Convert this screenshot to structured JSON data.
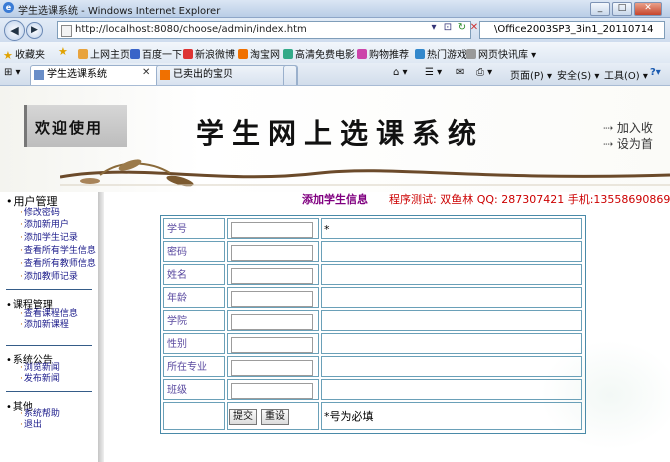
{
  "window": {
    "title": "学生选课系统 - Windows Internet Explorer",
    "btn_min": "_",
    "btn_max": "□",
    "btn_close": "✕"
  },
  "address": {
    "url": "http://localhost:8080/choose/admin/index.htm",
    "search_text": "\\Office2003SP3_3in1_20110714"
  },
  "favorites": {
    "label": "收藏夹",
    "items": [
      "上网主页",
      "百度一下",
      "新浪微博",
      "淘宝网",
      "高清免费电影",
      "购物推荐",
      "热门游戏",
      "网页快讯库"
    ]
  },
  "tabs": {
    "active": "学生选课系统",
    "inactive": "已卖出的宝贝",
    "tools": [
      "页面(P)",
      "安全(S)",
      "工具(O)"
    ]
  },
  "banner": {
    "welcome": "欢迎使用",
    "title": "学生网上选课系统",
    "quick1": "加入收",
    "quick2": "设为首"
  },
  "sidebar": {
    "sections": [
      {
        "title": "用户管理",
        "links": [
          "修改密码",
          "添加新用户",
          "添加学生记录",
          "查看所有学生信息",
          "查看所有教师信息",
          "添加教师记录"
        ]
      },
      {
        "title": "课程管理",
        "links": [
          "查看课程信息",
          "添加新课程"
        ]
      },
      {
        "title": "系统公告",
        "links": [
          "浏览新闻",
          "发布新闻"
        ]
      },
      {
        "title": "其他",
        "links": [
          "系统帮助",
          "退出"
        ]
      }
    ]
  },
  "form": {
    "heading": "添加学生信息",
    "author": "程序测试: 双鱼林 QQ: 287307421 手机:13558690869",
    "fields": [
      "学号",
      "密码",
      "姓名",
      "年龄",
      "学院",
      "性别",
      "所在专业",
      "班级"
    ],
    "required_mark": "*",
    "submit": "提交",
    "reset": "重设",
    "note": "*号为必填"
  },
  "colors": {
    "form_title": "#800080",
    "author": "#cc0000",
    "label": "#5a4aa0",
    "table_border": "#4a8aa8"
  }
}
